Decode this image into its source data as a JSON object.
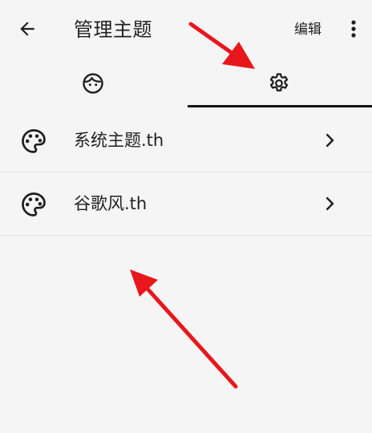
{
  "header": {
    "back_icon": "arrow-left-icon",
    "title": "管理主题",
    "edit_label": "编辑",
    "more_icon": "more-vert-icon"
  },
  "tabs": [
    {
      "icon": "face-icon",
      "selected": false
    },
    {
      "icon": "gear-icon",
      "selected": true
    }
  ],
  "themes": [
    {
      "icon": "palette-icon",
      "label": "系统主题.th",
      "chevron": "chevron-right-icon"
    },
    {
      "icon": "palette-icon",
      "label": "谷歌风.th",
      "chevron": "chevron-right-icon"
    }
  ],
  "colors": {
    "background": "#f5f5f6",
    "text": "#1f1f1f",
    "indicator": "#111111",
    "annotation_arrow": "#e8171b"
  }
}
